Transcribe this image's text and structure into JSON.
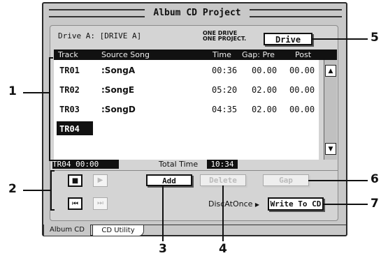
{
  "window": {
    "title": "Album CD Project"
  },
  "drive": {
    "label": "Drive A: [DRIVE A]",
    "note_line1": "ONE DRIVE",
    "note_line2": "ONE PROJECT.",
    "button": "Drive"
  },
  "table": {
    "headers": [
      "Track",
      "Source Song",
      "Time",
      "Gap: Pre",
      "Post"
    ],
    "rows": [
      {
        "track": "TR01",
        "song": ":SongA",
        "time": "00:36",
        "pre": "00.00",
        "post": "00.00"
      },
      {
        "track": "TR02",
        "song": ":SongE",
        "time": "05:20",
        "pre": "02.00",
        "post": "00.00"
      },
      {
        "track": "TR03",
        "song": ":SongD",
        "time": "04:35",
        "pre": "02.00",
        "post": "00.00"
      },
      {
        "track": "TR04",
        "song": "",
        "time": "",
        "pre": "",
        "post": ""
      }
    ],
    "selected": "TR04"
  },
  "status": {
    "track_time": "TR04  00:00",
    "total_label": "Total Time",
    "total_value": "10:34"
  },
  "transport": {
    "stop": "■",
    "play": "▶",
    "rewind": "⏮",
    "forward": "⏭"
  },
  "buttons": {
    "add": "Add",
    "delete": "Delete",
    "gap": "Gap",
    "disc_mode": "DiscAtOnce",
    "write": "Write To CD"
  },
  "tabs": [
    {
      "label": "Album CD"
    },
    {
      "label": "CD Utility"
    }
  ],
  "callouts": [
    "1",
    "2",
    "3",
    "4",
    "5",
    "6",
    "7"
  ]
}
